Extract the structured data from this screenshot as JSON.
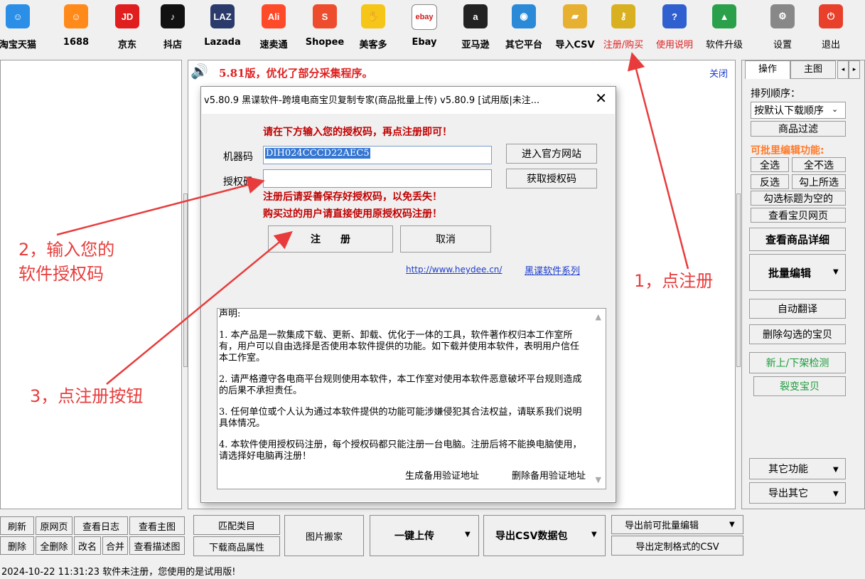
{
  "toolbar": {
    "items": [
      {
        "label": "淘宝天猫",
        "icon": "taobao-icon",
        "glyph": "☺",
        "color": "#2b8fe8"
      },
      {
        "label": "1688",
        "icon": "1688-icon",
        "glyph": "☺",
        "color": "#ff8a1a"
      },
      {
        "label": "京东",
        "icon": "jd-icon",
        "glyph": "JD",
        "color": "#e01e1e"
      },
      {
        "label": "抖店",
        "icon": "douyin-icon",
        "glyph": "♪",
        "color": "#111111"
      },
      {
        "label": "Lazada",
        "icon": "lazada-icon",
        "glyph": "LAZ",
        "color": "#2a3a6a"
      },
      {
        "label": "速卖通",
        "icon": "aliexpress-icon",
        "glyph": "Ali",
        "color": "#ff4a2a"
      },
      {
        "label": "Shopee",
        "icon": "shopee-icon",
        "glyph": "S",
        "color": "#ee4d2d"
      },
      {
        "label": "美客多",
        "icon": "mercadolibre-icon",
        "glyph": "✋",
        "color": "#f5c518"
      },
      {
        "label": "Ebay",
        "icon": "ebay-icon",
        "glyph": "ebay",
        "color": "#ffffff"
      },
      {
        "label": "亚马逊",
        "icon": "amazon-icon",
        "glyph": "a",
        "color": "#222222"
      },
      {
        "label": "其它平台",
        "icon": "globe-computer-icon",
        "glyph": "◉",
        "color": "#2a8ad8"
      },
      {
        "label": "导入CSV",
        "icon": "folder-icon",
        "glyph": "▰",
        "color": "#e8b030"
      },
      {
        "label": "注册/购买",
        "icon": "key-icon",
        "glyph": "⚷",
        "color": "#d8b020"
      },
      {
        "label": "使用说明",
        "icon": "help-icon",
        "glyph": "?",
        "color": "#3060d0"
      },
      {
        "label": "软件升级",
        "icon": "upgrade-icon",
        "glyph": "▲",
        "color": "#2aa04a"
      },
      {
        "label": "设置",
        "icon": "gear-icon",
        "glyph": "⚙",
        "color": "#888888"
      },
      {
        "label": "退出",
        "icon": "power-icon",
        "glyph": "⏻",
        "color": "#e8402a"
      }
    ]
  },
  "notice": {
    "text": "5.81版，优化了部分采集程序。",
    "close": "关闭"
  },
  "right_panel": {
    "tabs": [
      "操作",
      "主图"
    ],
    "sort_label": "排列顺序：",
    "sort_value": "按默认下载顺序",
    "filter": "商品过滤",
    "batch_title": "可批里编辑功能:",
    "select_all": "全选",
    "select_none": "全不选",
    "invert": "反选",
    "check_above": "勾上所选",
    "check_empty_title": "勾选标题为空的",
    "view_page": "查看宝贝网页",
    "view_detail": "查看商品详细",
    "batch_edit": "批量编辑",
    "auto_translate": "自动翻译",
    "delete_checked": "删除勾选的宝贝",
    "shelf_check": "新上/下架检测",
    "fission": "裂变宝贝",
    "other_func": "其它功能",
    "export_other": "导出其它"
  },
  "bottom": {
    "refresh": "刷新",
    "original": "原网页",
    "view_log": "查看日志",
    "view_main": "查看主图",
    "delete": "删除",
    "delete_all": "全删除",
    "rename": "改名",
    "merge": "合并",
    "view_desc": "查看描述图",
    "match_cat": "匹配类目",
    "download_attr": "下载商品属性",
    "image_move": "图片搬家",
    "one_key_upload": "一键上传",
    "export_csv": "导出CSV数据包",
    "export_before": "导出前可批量编辑",
    "export_custom": "导出定制格式的CSV"
  },
  "status": {
    "text": "2024-10-22 11:31:23   软件未注册，您使用的是试用版!"
  },
  "dialog": {
    "title": "v5.80.9 黑谍软件-跨境电商宝贝复制专家(商品批量上传) v5.80.9 [试用版|未注...",
    "prompt": "请在下方输入您的授权码，再点注册即可！",
    "machine_label": "机器码",
    "machine_value": "DIH024CCCD22AEC5",
    "auth_label": "授权码",
    "auth_value": "",
    "visit_site": "进入官方网站",
    "get_code": "获取授权码",
    "warn1": "注册后请妥善保存好授权码，以免丢失！",
    "warn2": "购买过的用户请直接使用原授权码注册！",
    "register": "注　　册",
    "cancel": "取消",
    "link": "http://www.heydee.cn/",
    "series": "黑谍软件系列",
    "declaration": [
      "声明:",
      "1. 本产品是一款集成下载、更新、卸载、优化于一体的工具，软件著作权归本工作室所有，用户可以自由选择是否使用本软件提供的功能。如下载并使用本软件，表明用户信任本工作室。",
      "2. 请严格遵守各电商平台规则使用本软件，本工作室对使用本软件恶意破坏平台规则造成的后果不承担责任。",
      "3. 任何单位或个人认为通过本软件提供的功能可能涉嫌侵犯其合法权益，请联系我们说明具体情况。",
      "4. 本软件使用授权码注册，每个授权码都只能注册一台电脑。注册后将不能换电脑使用，请选择好电脑再注册！"
    ],
    "gen_backup": "生成备用验证地址",
    "del_backup": "删除备用验证地址"
  },
  "annotations": {
    "step1": "1，点注册",
    "step2a": "2，输入您的",
    "step2b": "软件授权码",
    "step3": "3，点注册按钮"
  },
  "colors": {
    "accent_red": "#e02020",
    "annotation": "#e83c3c",
    "selection": "#3476d2"
  }
}
